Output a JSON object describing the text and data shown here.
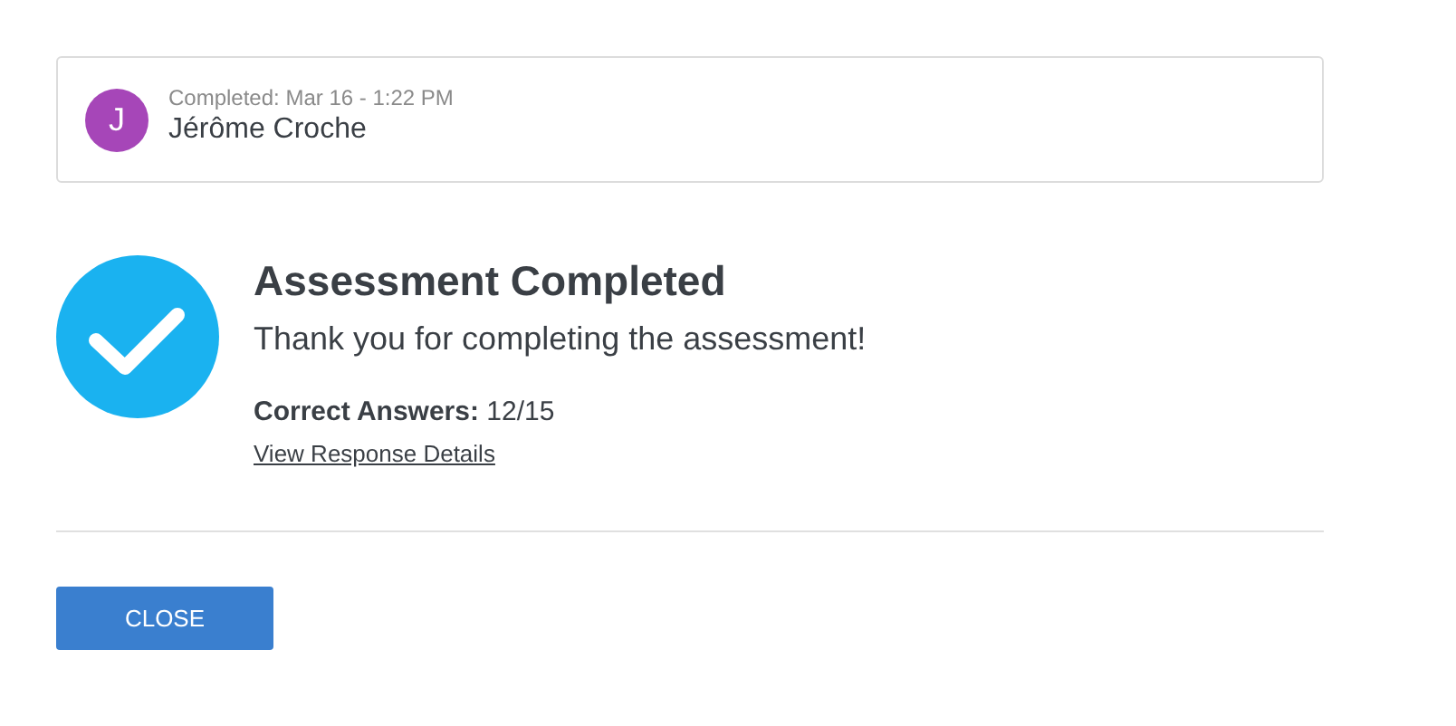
{
  "submission": {
    "avatar_initial": "J",
    "completed": "Completed: Mar 16 - 1:22 PM",
    "name": "Jérôme Croche"
  },
  "result": {
    "title": "Assessment Completed",
    "message": "Thank you for completing the assessment!",
    "score": "**Correct Answers:** 12/15",
    "link": "View Response Details"
  },
  "buttons": [
    {
      "label": "CLOSE"
    }
  ]
}
